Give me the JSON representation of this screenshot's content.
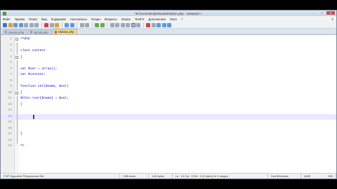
{
  "window": {
    "title": "*E:\\home\\simple\\www\\shablon.php - Notepad++"
  },
  "menu": {
    "items": [
      "Файл",
      "Правка",
      "Поиск",
      "Вид",
      "Кодировки",
      "Синтаксисы",
      "Опции",
      "Макросы",
      "Запуск",
      "TextFX",
      "Дополнения",
      "Окна",
      "?"
    ],
    "close": "X"
  },
  "tabs": [
    {
      "label": "classes.php",
      "active": false
    },
    {
      "label": "sql.tab.php",
      "active": false
    },
    {
      "label": "shablon.php",
      "active": true
    }
  ],
  "editor": {
    "lines": [
      {
        "n": "1",
        "text": "<?php",
        "cls": "php-open",
        "fold": "minus"
      },
      {
        "n": "2",
        "text": "",
        "fold": "line"
      },
      {
        "n": "3",
        "text": "class content",
        "fold": "line"
      },
      {
        "n": "4",
        "text": "{",
        "fold": "minus"
      },
      {
        "n": "5",
        "text": "",
        "fold": "line"
      },
      {
        "n": "6",
        "text": "var $var = array();",
        "fold": "line"
      },
      {
        "n": "7",
        "text": "var $content;",
        "fold": "line"
      },
      {
        "n": "8",
        "text": "",
        "fold": "line"
      },
      {
        "n": "9",
        "text": "function set($name, $val)",
        "fold": "line"
      },
      {
        "n": "10",
        "text": "{",
        "fold": "minus"
      },
      {
        "n": "11",
        "text": "$this->var[$name] = $val;",
        "fold": "line"
      },
      {
        "n": "12",
        "text": "}",
        "fold": "line"
      },
      {
        "n": "13",
        "text": "",
        "fold": "line"
      },
      {
        "n": "14",
        "text": "",
        "fold": "line",
        "current": true
      },
      {
        "n": "15",
        "text": "",
        "fold": "line"
      },
      {
        "n": "16",
        "text": "",
        "fold": "line"
      },
      {
        "n": "17",
        "text": "}",
        "fold": "line"
      },
      {
        "n": "18",
        "text": "",
        "fold": "line"
      },
      {
        "n": "19",
        "text": "?>",
        "cls": "php-close",
        "fold": "none"
      }
    ]
  },
  "status": {
    "language": "PHP Hypertext Preprocessor file",
    "length": "198 chars",
    "lines": "140 bytes",
    "lines_count": "19 lines",
    "position": "Ln : 14   Col : 5   Sel : 0 (0 bytes) in 0 ranges",
    "eol": "Dos\\Windows",
    "encoding": "ANSI",
    "mode": "INS"
  },
  "colors": {
    "active_tab": "#f5d98a",
    "keyword": "#0000c0",
    "php_tag": "#d00000",
    "current_line": "#e8e8ff"
  }
}
